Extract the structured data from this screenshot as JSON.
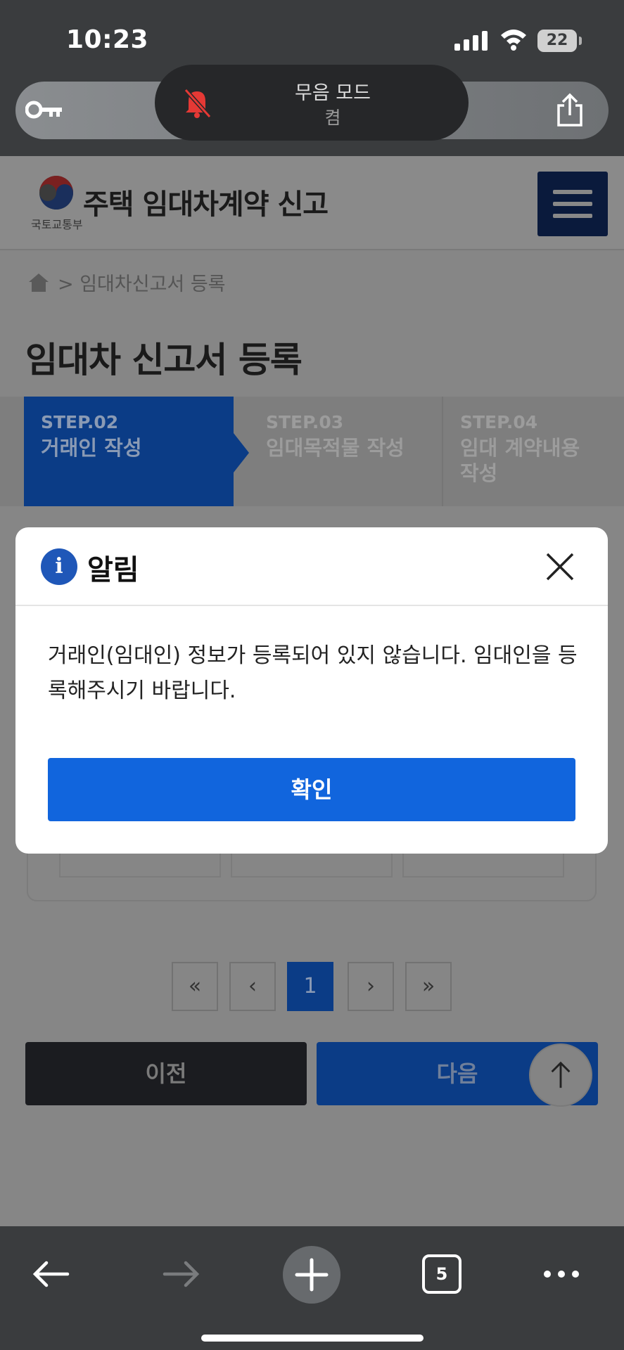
{
  "status_bar": {
    "time": "10:23",
    "battery": "22"
  },
  "silent_mode": {
    "title": "무음 모드",
    "state": "켬"
  },
  "site": {
    "org": "국토교통부",
    "title": "주택 임대차계약 신고"
  },
  "breadcrumb": {
    "separator": ">",
    "current": "임대차신고서 등록"
  },
  "page_title": "임대차 신고서 등록",
  "steps": [
    {
      "no": "STEP.02",
      "name": "거래인 작성"
    },
    {
      "no": "STEP.03",
      "name": "임대목적물 작성"
    },
    {
      "no": "STEP.04",
      "name": "임대 계약내용 작성"
    }
  ],
  "pagination": {
    "first": "«",
    "prev": "‹",
    "current": "1",
    "next": "›",
    "last": "»"
  },
  "nav_buttons": {
    "prev": "이전",
    "next": "다음"
  },
  "modal": {
    "icon": "i",
    "title": "알림",
    "message": "거래인(임대인) 정보가 등록되어 있지 않습니다. 임대인을 등록해주시기 바랍니다.",
    "confirm": "확인"
  },
  "toolbar": {
    "tab_count": "5"
  },
  "colors": {
    "accent": "#1165dd",
    "step_active": "#0b3c86",
    "dark_button": "#1b1c20"
  }
}
